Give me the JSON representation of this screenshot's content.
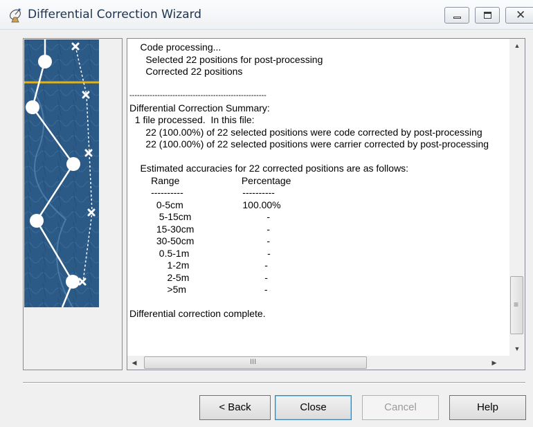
{
  "window": {
    "title": "Differential Correction Wizard",
    "icon": "satellite-dish-icon"
  },
  "log": {
    "lines": [
      "    Code processing...",
      "      Selected 22 positions for post-processing",
      "      Corrected 22 positions",
      "",
      "------------------------------------------------------",
      "Differential Correction Summary:",
      "  1 file processed.  In this file:",
      "      22 (100.00%) of 22 selected positions were code corrected by post-processing",
      "      22 (100.00%) of 22 selected positions were carrier corrected by post-processing",
      "",
      "    Estimated accuracies for 22 corrected positions are as follows:",
      "        Range                       Percentage",
      "        ----------                      ----------",
      "          0-5cm                      100.00%",
      "           5-15cm                            -",
      "          15-30cm                           -",
      "          30-50cm                           -",
      "           0.5-1m                             -",
      "              1-2m                            -",
      "              2-5m                            -",
      "              >5m                             -",
      "",
      "Differential correction complete."
    ]
  },
  "scrollbars": {
    "vertical_grip": "≡",
    "horizontal_grip": "III"
  },
  "buttons": {
    "back": "< Back",
    "close": "Close",
    "cancel": "Cancel",
    "help": "Help"
  },
  "colors": {
    "panel_blue": "#2b5a86",
    "accent_line": "#e8b20a"
  }
}
